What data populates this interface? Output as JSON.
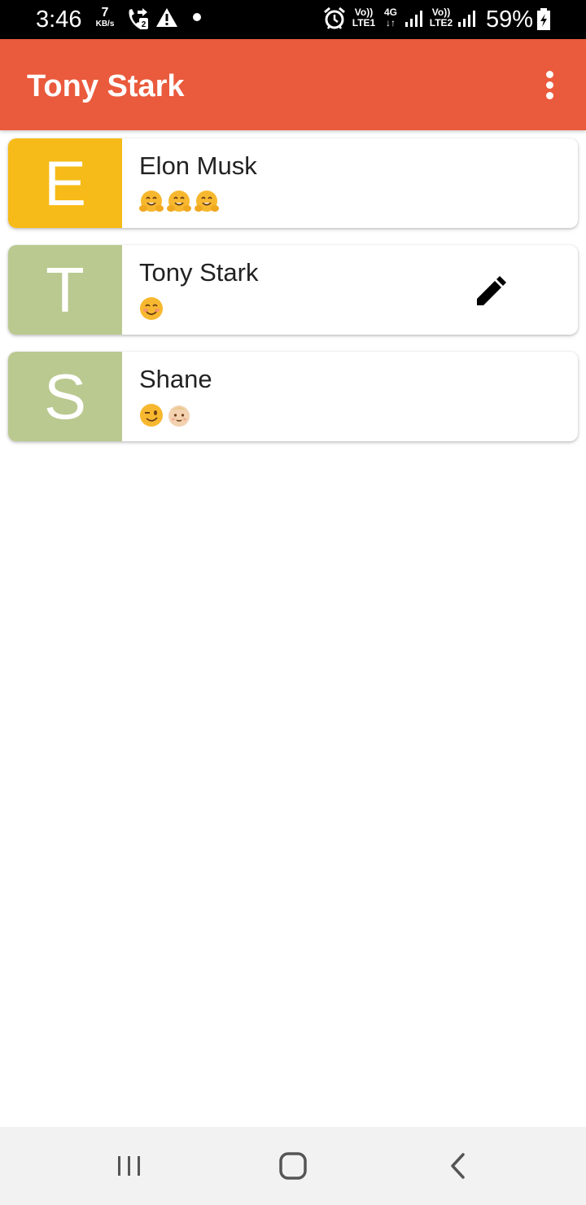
{
  "status_bar": {
    "time": "3:46",
    "net_speed_value": "7",
    "net_speed_unit": "KB/s",
    "sim1_label_top": "Vo))",
    "sim1_label_bottom": "LTE1",
    "net_type": "4G",
    "sim2_label_top": "Vo))",
    "sim2_label_bottom": "LTE2",
    "battery": "59%",
    "icons": [
      "call-forward-icon",
      "warning-icon",
      "notification-dot",
      "alarm-icon",
      "signal-icon",
      "signal-icon",
      "battery-charging-icon"
    ]
  },
  "app_bar": {
    "title": "Tony Stark",
    "menu_icon": "more-vert-icon"
  },
  "contacts": [
    {
      "initial": "E",
      "name": "Elon Musk",
      "avatar_color": "#f6bb18",
      "status_emojis": [
        "hugging-face",
        "hugging-face",
        "hugging-face"
      ]
    },
    {
      "initial": "T",
      "name": "Tony Stark",
      "avatar_color": "#bac990",
      "status_emojis": [
        "smiling-face"
      ],
      "edit_icon": "pencil-edit-icon"
    },
    {
      "initial": "S",
      "name": "Shane",
      "avatar_color": "#bac990",
      "status_emojis": [
        "winking-face",
        "baby-face"
      ]
    }
  ],
  "colors": {
    "app_bar": "#ea5a3c",
    "background": "#ffffff",
    "nav_bar": "#f2f2f2"
  },
  "nav_bar": {
    "buttons": [
      "recent-apps-icon",
      "home-icon",
      "back-icon"
    ]
  }
}
